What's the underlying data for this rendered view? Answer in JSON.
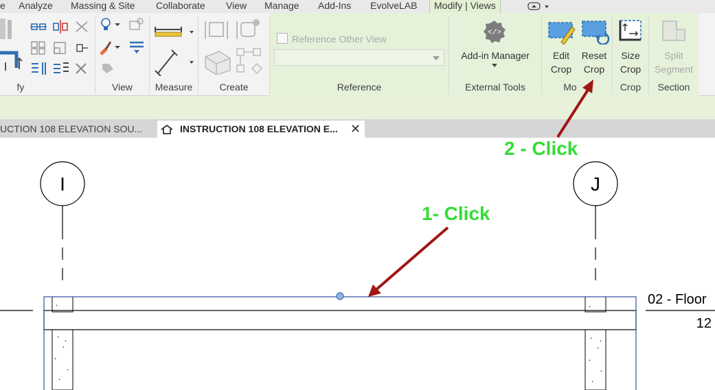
{
  "menu": {
    "items": [
      "e",
      "Analyze",
      "Massing & Site",
      "Collaborate",
      "View",
      "Manage",
      "Add-Ins",
      "EvolveLAB",
      "Modify | Views"
    ],
    "active_index": 8
  },
  "ribbon": {
    "panels": {
      "modify": "fy",
      "view": "View",
      "measure": "Measure",
      "create": "Create",
      "reference": "Reference",
      "external_tools": "External Tools",
      "mode": "Mo",
      "crop": "Crop",
      "section": "Section"
    },
    "reference_other_view_label": "Reference Other View",
    "reference_dropdown_value": "",
    "addin_manager": "Add-in Manager",
    "edit_crop": [
      "Edit",
      "Crop"
    ],
    "reset_crop": [
      "Reset",
      "Crop"
    ],
    "size_crop": [
      "Size",
      "Crop"
    ],
    "split_segment": [
      "Split",
      "Segment"
    ],
    "icons": [
      "align-icon",
      "mirror-icon",
      "offset-icon",
      "lightbulb-icon",
      "paint-icon",
      "linework-icon",
      "measure-between-icon",
      "dimension-icon",
      "create-parts-icon",
      "create-assembly-icon",
      "addin-manager-icon",
      "edit-crop-icon",
      "reset-crop-icon",
      "size-crop-icon",
      "split-segment-icon"
    ]
  },
  "tabs": [
    {
      "label": "UCTION 108 ELEVATION SOU..."
    },
    {
      "label": "INSTRUCTION 108 ELEVATION E...",
      "close": "✕"
    }
  ],
  "drawing": {
    "grid_left": "I",
    "grid_right": "J",
    "level_name": "02 - Floor",
    "level_elevation": "12"
  },
  "annotations": {
    "step1": "1- Click",
    "step2": "2 - Click"
  },
  "colors": {
    "accent_green": "#33dd33",
    "arrow_red": "#a01515",
    "context_tab_green": "#e4f0d4",
    "crop_region_blue": "#2f4f9a",
    "icon_blue": "#2d6fb4"
  }
}
